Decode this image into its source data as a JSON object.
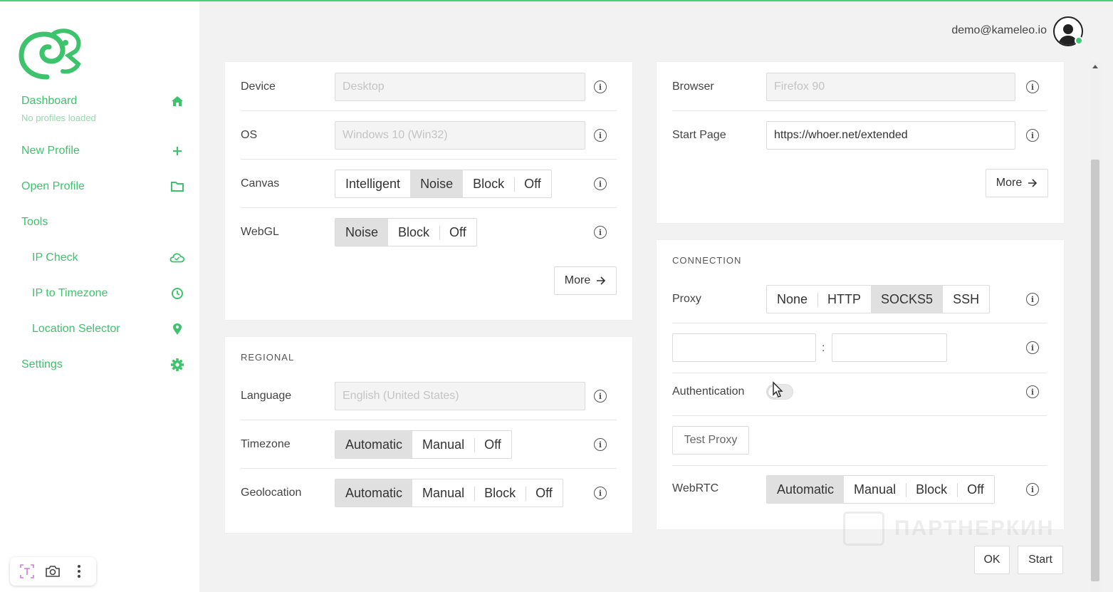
{
  "user": {
    "email": "demo@kameleo.io"
  },
  "sidebar": {
    "items": [
      {
        "label": "Dashboard",
        "sublabel": "No profiles loaded",
        "icon": "home-icon"
      },
      {
        "label": "New Profile",
        "icon": "plus-icon"
      },
      {
        "label": "Open Profile",
        "icon": "folder-icon"
      },
      {
        "label": "Tools"
      },
      {
        "label": "IP Check",
        "icon": "cloud-check-icon"
      },
      {
        "label": "IP to Timezone",
        "icon": "clock-icon"
      },
      {
        "label": "Location Selector",
        "icon": "location-pin-icon"
      },
      {
        "label": "Settings",
        "icon": "gear-icon"
      }
    ]
  },
  "device_card": {
    "device_label": "Device",
    "device_value": "Desktop",
    "os_label": "OS",
    "os_value": "Windows 10 (Win32)",
    "canvas_label": "Canvas",
    "canvas_options": [
      "Intelligent",
      "Noise",
      "Block",
      "Off"
    ],
    "canvas_selected": "Noise",
    "webgl_label": "WebGL",
    "webgl_options": [
      "Noise",
      "Block",
      "Off"
    ],
    "webgl_selected": "Noise",
    "more_label": "More"
  },
  "regional_card": {
    "title": "REGIONAL",
    "language_label": "Language",
    "language_value": "English (United States)",
    "timezone_label": "Timezone",
    "timezone_options": [
      "Automatic",
      "Manual",
      "Off"
    ],
    "timezone_selected": "Automatic",
    "geolocation_label": "Geolocation",
    "geolocation_options": [
      "Automatic",
      "Manual",
      "Block",
      "Off"
    ],
    "geolocation_selected": "Automatic"
  },
  "browser_card": {
    "browser_label": "Browser",
    "browser_value": "Firefox 90",
    "startpage_label": "Start Page",
    "startpage_value": "https://whoer.net/extended",
    "more_label": "More"
  },
  "connection_card": {
    "title": "CONNECTION",
    "proxy_label": "Proxy",
    "proxy_options": [
      "None",
      "HTTP",
      "SOCKS5",
      "SSH"
    ],
    "proxy_selected": "SOCKS5",
    "host_value": "",
    "port_value": "",
    "separator": ":",
    "auth_label": "Authentication",
    "test_proxy_label": "Test Proxy",
    "webrtc_label": "WebRTC",
    "webrtc_options": [
      "Automatic",
      "Manual",
      "Block",
      "Off"
    ],
    "webrtc_selected": "Automatic"
  },
  "footer": {
    "ok_label": "OK",
    "start_label": "Start"
  },
  "watermark": {
    "text": "ПАРТНЕРКИН"
  },
  "colors": {
    "accent": "#3cc36b",
    "selected_segment": "#e0e0e0"
  }
}
